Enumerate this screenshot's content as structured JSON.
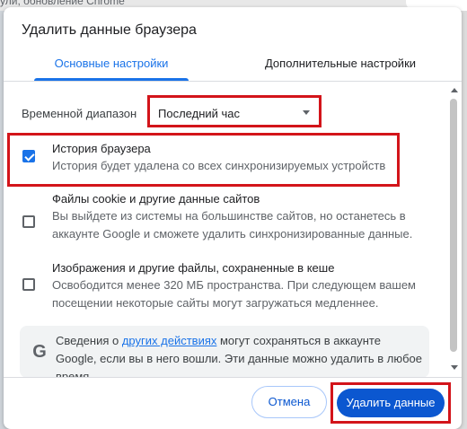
{
  "background": {
    "top_text": "ули, обновление Chrome"
  },
  "dialog": {
    "title": "Удалить данные браузера",
    "tabs": [
      {
        "label": "Основные настройки",
        "active": true
      },
      {
        "label": "Дополнительные настройки",
        "active": false
      }
    ],
    "time_range": {
      "label": "Временной диапазон",
      "selected": "Последний час"
    },
    "options": [
      {
        "title": "История браузера",
        "description": "История будет удалена со всех синхронизируемых устройств",
        "checked": true
      },
      {
        "title": "Файлы cookie и другие данные сайтов",
        "description": "Вы выйдете из системы на большинстве сайтов, но останетесь в аккаунте Google и сможете удалить синхронизированные данные.",
        "checked": false
      },
      {
        "title": "Изображения и другие файлы, сохраненные в кеше",
        "description": "Освободится менее 320 МБ пространства. При следующем вашем посещении некоторые сайты могут загружаться медленнее.",
        "checked": false
      }
    ],
    "info": {
      "icon": "google-g-icon",
      "text_before": "Сведения о ",
      "link": "других действиях",
      "text_after": " могут сохраняться в аккаунте Google, если вы в него вошли. Эти данные можно удалить в любое время."
    },
    "buttons": {
      "cancel": "Отмена",
      "delete": "Удалить данные"
    }
  },
  "colors": {
    "accent": "#1a73e8",
    "primary_button": "#0b57d0",
    "highlight": "#d3141a"
  }
}
